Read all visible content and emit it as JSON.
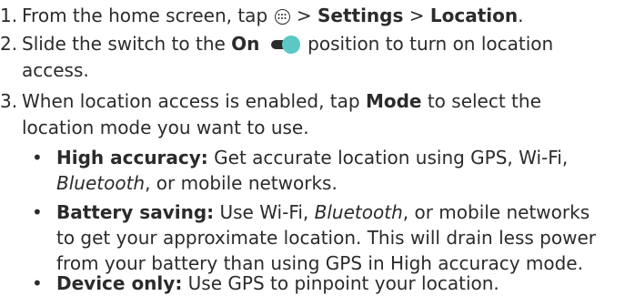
{
  "steps": [
    {
      "number": "1.",
      "pre": "From the home screen, tap",
      "sep1": ">",
      "settings": "Settings",
      "sep2": ">",
      "location": "Location",
      "end": ".",
      "icon": "apps-icon"
    },
    {
      "number": "2.",
      "pre": "Slide the switch to the",
      "on": "On",
      "post": "position to turn on location",
      "line2": "access.",
      "icon": "toggle-on-icon",
      "toggle_color": "#5bc8c4"
    },
    {
      "number": "3.",
      "pre": "When location access is enabled, tap",
      "mode": "Mode",
      "post": "to select the",
      "line2": "location mode you want to use."
    }
  ],
  "bullets": [
    {
      "marker": "•",
      "label": "High accuracy:",
      "line1_text": "Get accurate location using GPS, Wi-Fi,",
      "line2_italic": "Bluetooth",
      "line2_text": ", or mobile networks."
    },
    {
      "marker": "•",
      "label": "Battery saving:",
      "line1_text": "Use Wi-Fi,",
      "line1_italic": "Bluetooth",
      "line1_text2": ", or mobile networks",
      "line2": "to get your approximate location. This will drain less power",
      "line3": "from your battery than using GPS in High accuracy mode."
    },
    {
      "marker": "•",
      "label": "Device only:",
      "line1_text": "Use GPS to pinpoint your location."
    }
  ]
}
